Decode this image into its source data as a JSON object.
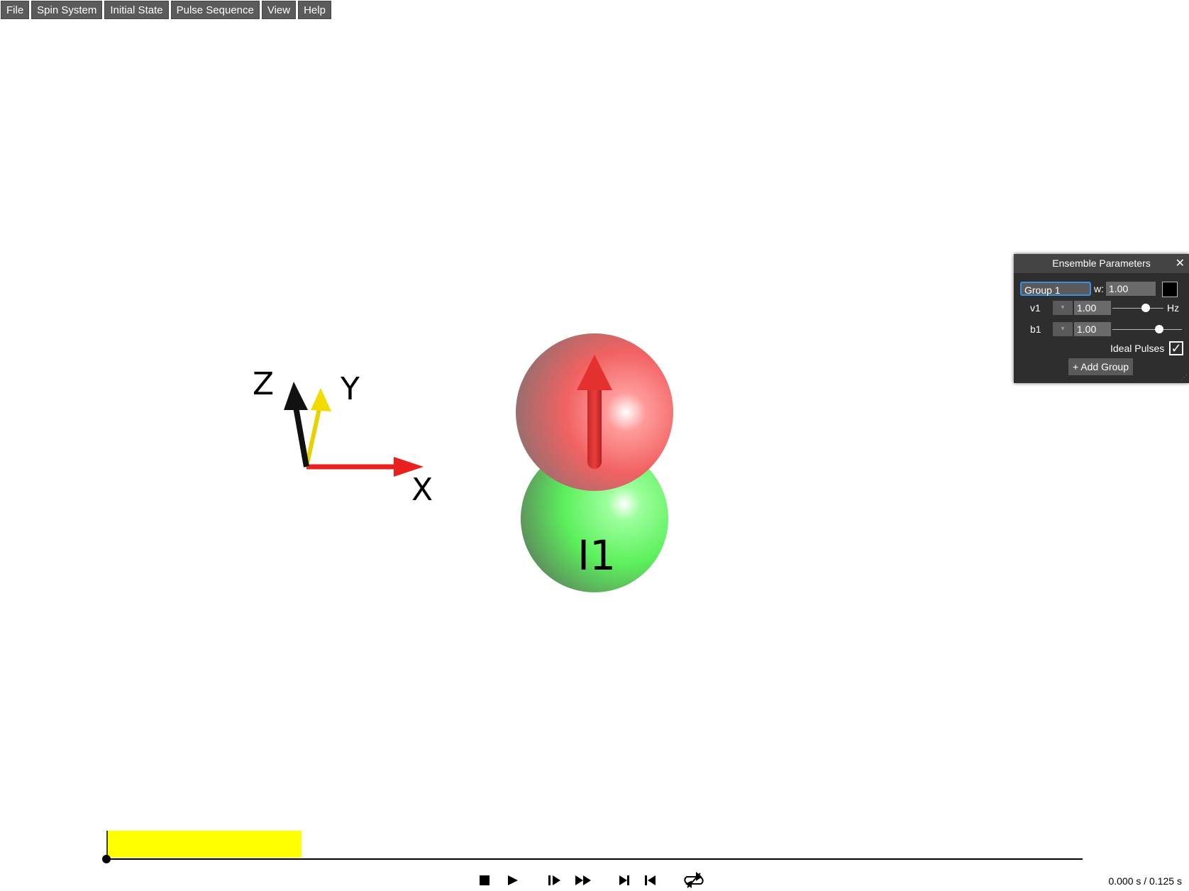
{
  "menu": {
    "items": [
      "File",
      "Spin System",
      "Initial State",
      "Pulse Sequence",
      "View",
      "Help"
    ]
  },
  "axes": {
    "x_label": "X",
    "y_label": "Y",
    "z_label": "Z"
  },
  "spin": {
    "label": "I1",
    "top_color": "#ef5b5b",
    "bottom_color": "#5ef25e",
    "arrow_color": "#e53030"
  },
  "panel": {
    "title": "Ensemble Parameters",
    "close_icon": "close-icon",
    "group_name": "Group 1",
    "w_label": "w:",
    "w_value": "1.00",
    "v1_label": "v1",
    "v1_value": "1.00",
    "v1_unit": "Hz",
    "v1_slider_level": 0.75,
    "b1_label": "b1",
    "b1_value": "1.00",
    "b1_slider_level": 0.7,
    "ideal_pulses_label": "Ideal Pulses",
    "ideal_pulses_checked": true,
    "add_group_label": "+ Add Group"
  },
  "timeline": {
    "pulse_color": "#ffff00",
    "pulse_fraction": 0.2,
    "time_readout": "0.000 s / 0.125 s"
  },
  "transport": {
    "icons": [
      "stop-icon",
      "play-icon",
      "step-forward-icon",
      "fast-forward-icon",
      "skip-to-end-icon",
      "skip-to-start-icon",
      "loop-icon"
    ]
  },
  "colors": {
    "x_axis": "#e8201e",
    "y_axis": "#f2dc00",
    "z_axis": "#111111"
  }
}
